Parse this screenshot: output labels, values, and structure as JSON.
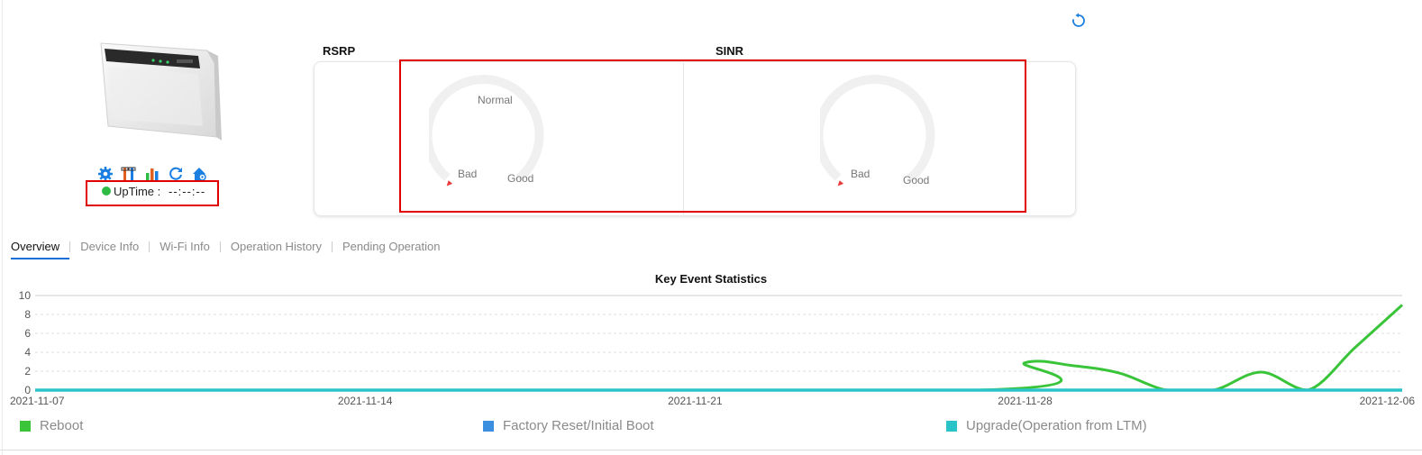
{
  "header": {
    "refresh_icon": "refresh-icon"
  },
  "device": {
    "image": "router-image",
    "actions": [
      {
        "icon": "gear-icon",
        "color": "#1a7fe0"
      },
      {
        "icon": "tools-icon",
        "color": "#e06020"
      },
      {
        "icon": "bar-chart-icon",
        "color": "#1a7fe0"
      },
      {
        "icon": "reboot-icon",
        "color": "#1a7fe0"
      },
      {
        "icon": "home-settings-icon",
        "color": "#1a7fe0"
      }
    ],
    "uptime_label": "UpTime :",
    "uptime_value": "--:--:--",
    "status_color": "#2dbb45"
  },
  "gauges": {
    "rsrp": {
      "title": "RSRP",
      "labels": {
        "normal": "Normal",
        "bad": "Bad",
        "good": "Good"
      }
    },
    "sinr": {
      "title": "SINR",
      "labels": {
        "bad": "Bad",
        "good": "Good"
      }
    }
  },
  "tabs": [
    "Overview",
    "Device Info",
    "Wi-Fi Info",
    "Operation History",
    "Pending Operation"
  ],
  "active_tab": "Overview",
  "chart_data": {
    "type": "line",
    "title": "Key Event Statistics",
    "xlabel": "",
    "ylabel": "",
    "x_tick_labels": [
      "2021-11-07",
      "2021-11-14",
      "2021-11-21",
      "2021-11-28",
      "2021-12-06"
    ],
    "xlim": [
      "2021-11-07",
      "2021-12-06"
    ],
    "ylim": [
      0,
      10
    ],
    "y_ticks": [
      0,
      2,
      4,
      6,
      8,
      10
    ],
    "grid": true,
    "legend_position": "bottom",
    "series": [
      {
        "name": "Reboot",
        "color": "#3ac43a",
        "points": [
          [
            "2021-11-07",
            0
          ],
          [
            "2021-11-27",
            0
          ],
          [
            "2021-11-28",
            2.9
          ],
          [
            "2021-11-29",
            2.6
          ],
          [
            "2021-11-30",
            1.8
          ],
          [
            "2021-12-01",
            0
          ],
          [
            "2021-12-02",
            0
          ],
          [
            "2021-12-03",
            1.9
          ],
          [
            "2021-12-04",
            0
          ],
          [
            "2021-12-05",
            4.5
          ],
          [
            "2021-12-06",
            9
          ]
        ]
      },
      {
        "name": "Factory Reset/Initial Boot",
        "color": "#3b8ee0",
        "points": [
          [
            "2021-11-07",
            0
          ],
          [
            "2021-12-06",
            0
          ]
        ]
      },
      {
        "name": "Upgrade(Operation from LTM)",
        "color": "#2ac3c8",
        "points": [
          [
            "2021-11-07",
            0
          ],
          [
            "2021-12-06",
            0
          ]
        ]
      }
    ]
  }
}
